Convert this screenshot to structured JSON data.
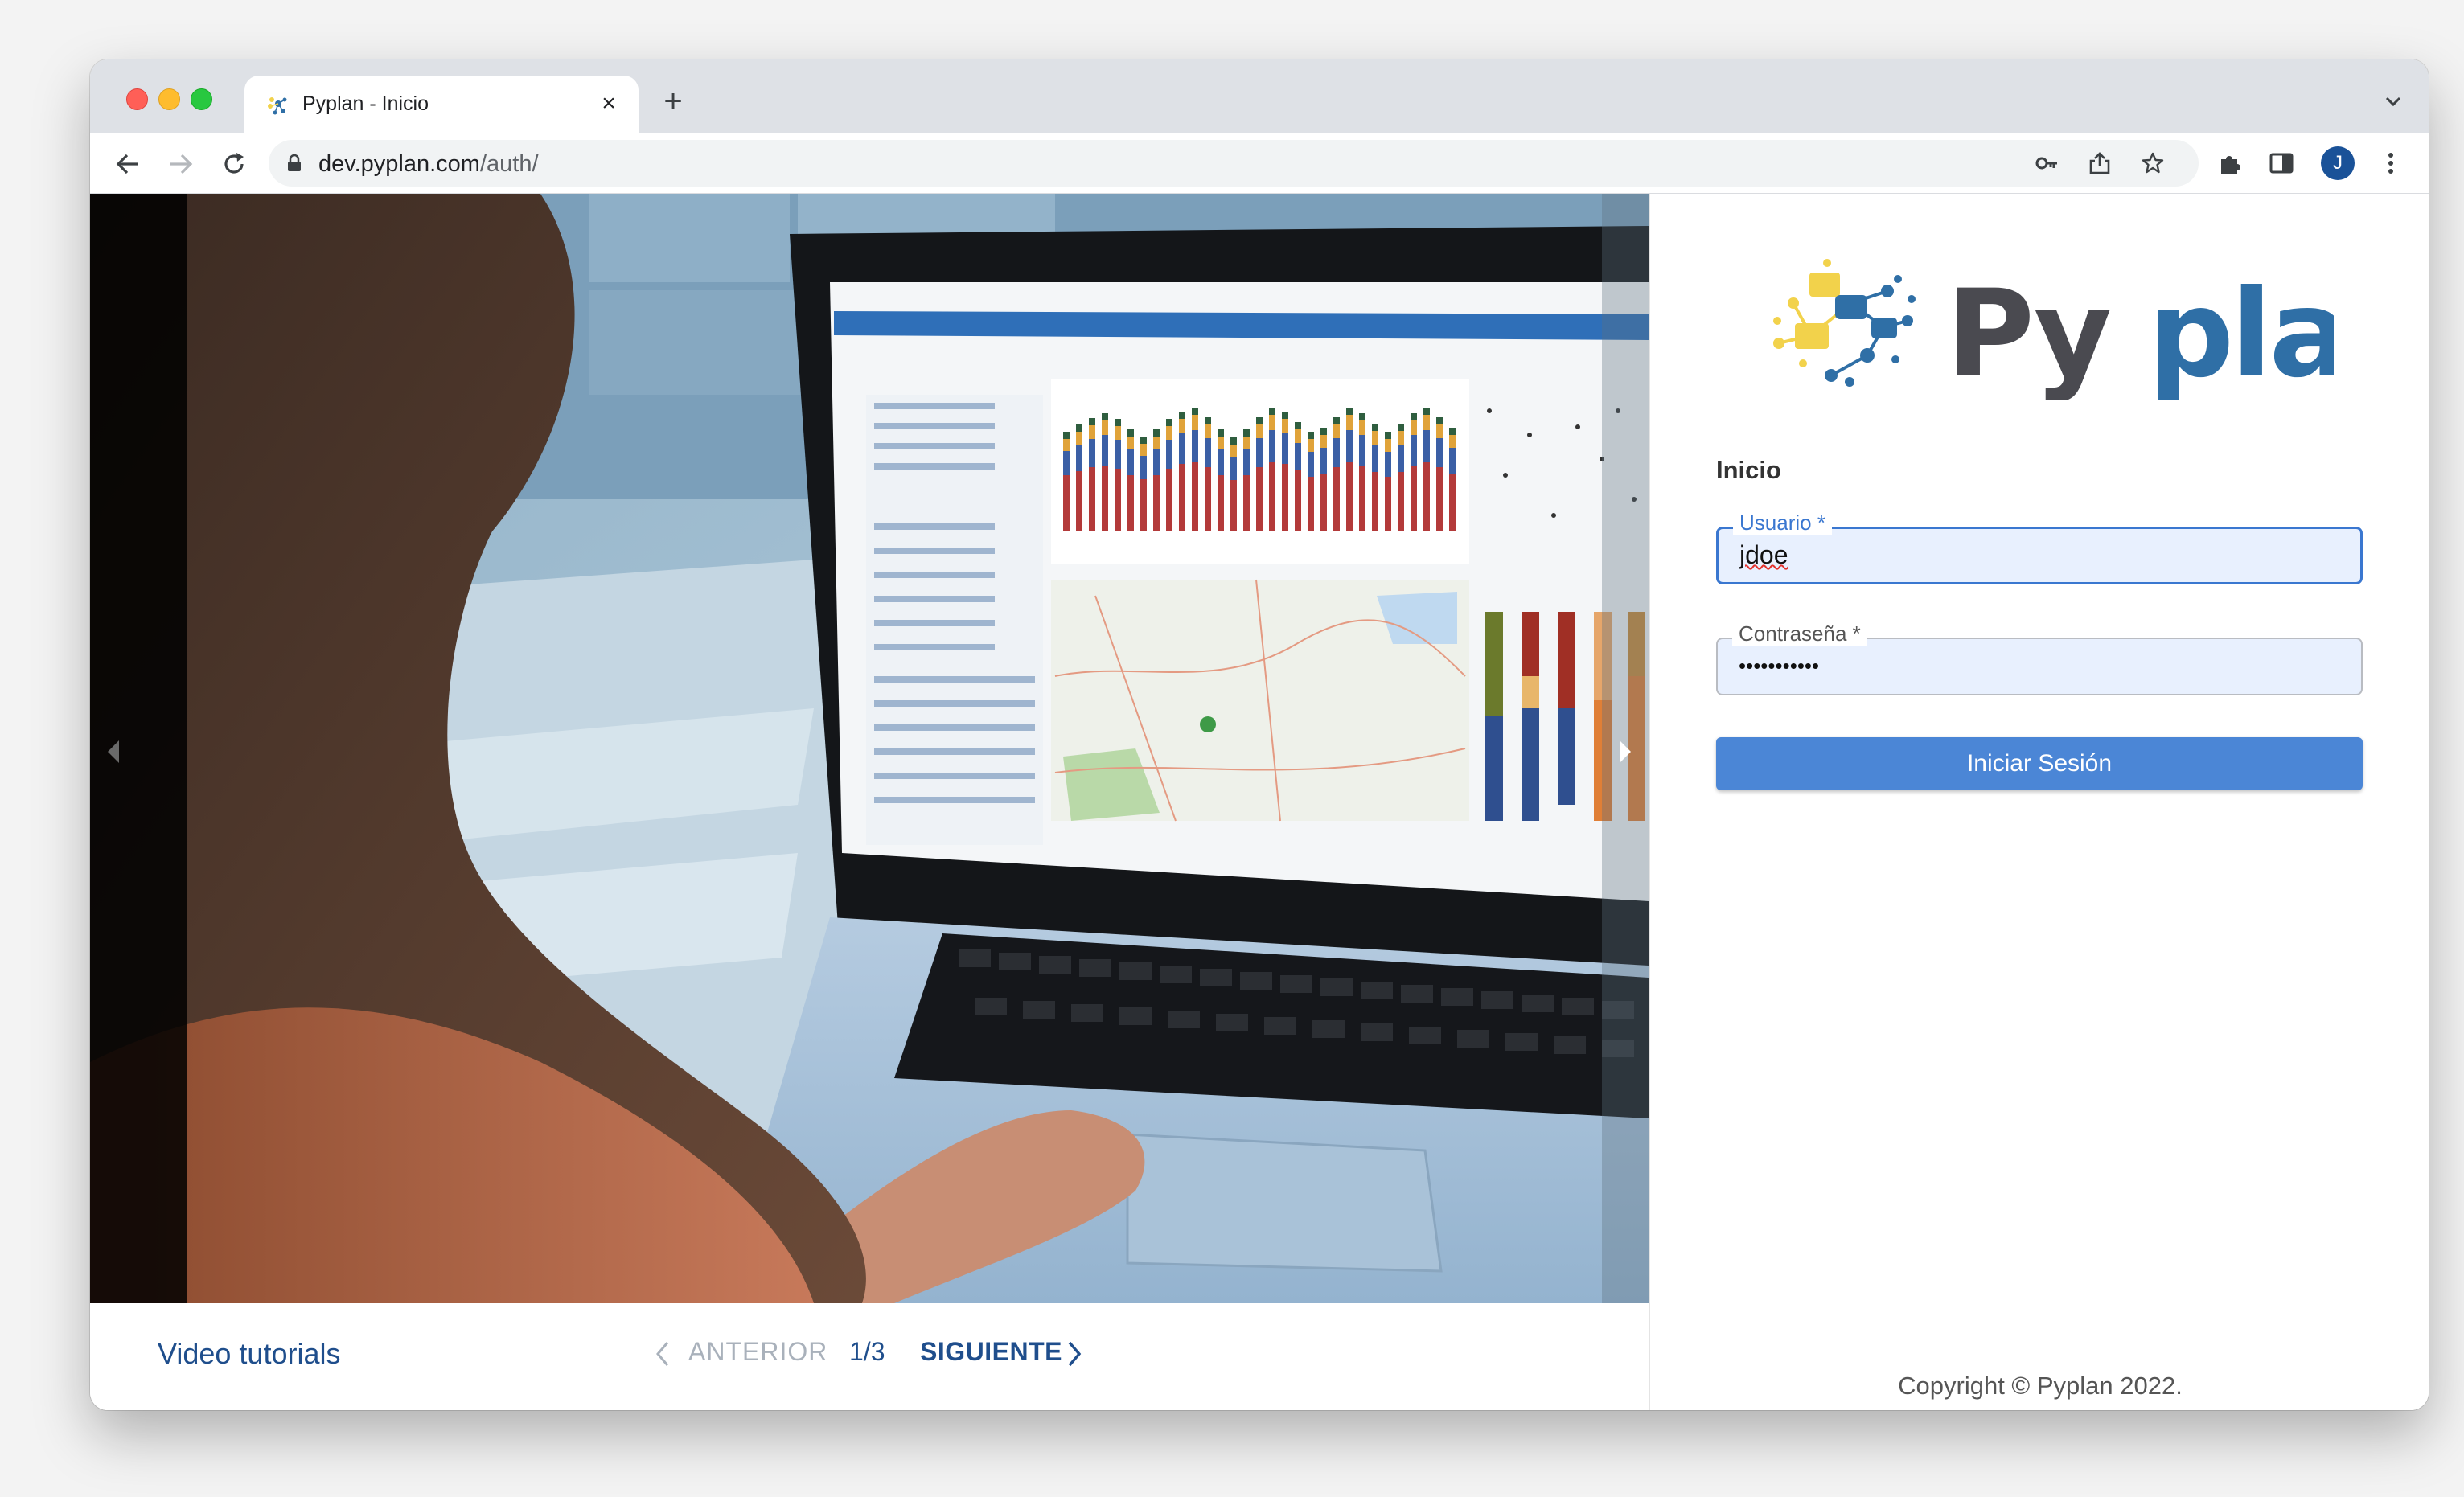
{
  "browser": {
    "tab_title": "Pyplan - Inicio",
    "url_host": "dev.pyplan.com",
    "url_path": "/auth/",
    "profile_initial": "J"
  },
  "carousel": {
    "title": "Video tutorials",
    "prev_label": "ANTERIOR",
    "counter": "1/3",
    "next_label": "SIGUIENTE"
  },
  "login": {
    "logo_text": "Pyplan",
    "heading": "Inicio",
    "username_label": "Usuario *",
    "username_value": "jdoe",
    "password_label": "Contraseña *",
    "password_value": "•••••••••••",
    "submit_label": "Iniciar Sesión",
    "copyright": "Copyright © Pyplan 2022."
  },
  "colors": {
    "accent": "#4b86d6",
    "brand_dark": "#1f4e8c",
    "logo_gray": "#4a4a50",
    "logo_blue": "#2f6fa6",
    "logo_yellow": "#f2d24b"
  }
}
